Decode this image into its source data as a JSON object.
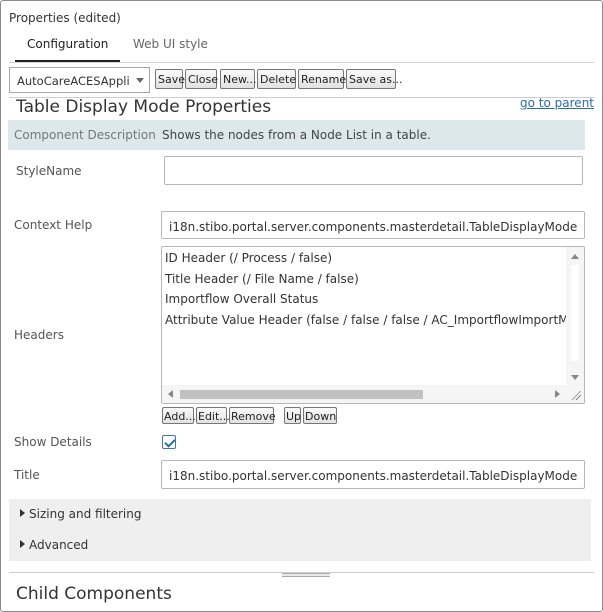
{
  "window": {
    "title": "Properties (edited)"
  },
  "tabs": [
    {
      "label": "Configuration",
      "active": true
    },
    {
      "label": "Web UI style",
      "active": false
    }
  ],
  "toolbar": {
    "config_select": "AutoCareACESApplic",
    "save": "Save",
    "close": "Close",
    "new": "New...",
    "delete": "Delete",
    "rename": "Rename",
    "save_as": "Save as..."
  },
  "panel": {
    "title": "Table Display Mode Properties",
    "goto_parent": "go to parent"
  },
  "fields": {
    "component_description": {
      "label": "Component Description",
      "value": "Shows the nodes from a Node List in a table."
    },
    "style_name": {
      "label": "StyleName",
      "value": ""
    },
    "context_help": {
      "label": "Context Help",
      "value": "i18n.stibo.portal.server.components.masterdetail.TableDisplayMode"
    },
    "headers": {
      "label": "Headers",
      "items": [
        "ID Header (/ Process / false)",
        "Title Header (/ File Name / false)",
        "Importflow Overall Status",
        "Attribute Value Header (false / false / false / AC_ImportflowImportMode /"
      ],
      "buttons": {
        "add": "Add...",
        "edit": "Edit...",
        "remove": "Remove",
        "up": "Up",
        "down": "Down"
      }
    },
    "show_details": {
      "label": "Show Details",
      "checked": true
    },
    "title": {
      "label": "Title",
      "value": "i18n.stibo.portal.server.components.masterdetail.TableDisplayMode"
    }
  },
  "sections": [
    {
      "label": "Sizing and filtering",
      "expanded": false
    },
    {
      "label": "Advanced",
      "expanded": false
    }
  ],
  "child_components": {
    "title": "Child Components"
  },
  "colors": {
    "accent": "#2a6db8",
    "description_bg": "#dde8ec",
    "section_bg": "#efefef",
    "link": "#2b6cb0"
  }
}
